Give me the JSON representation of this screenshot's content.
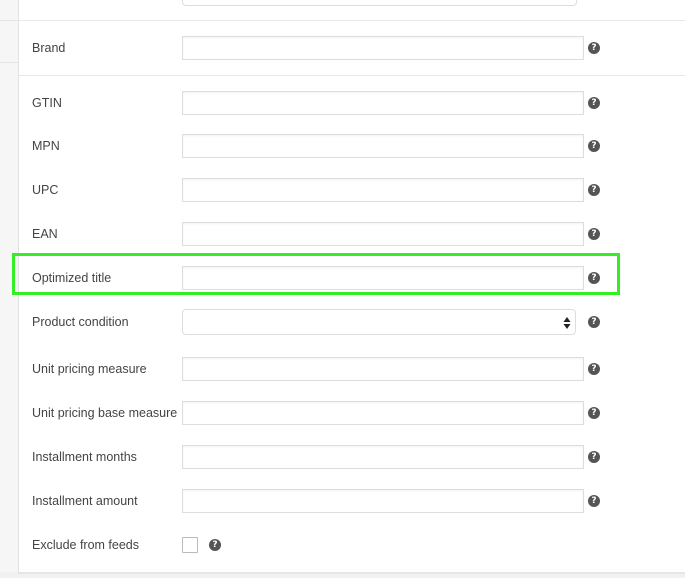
{
  "form": {
    "fields": [
      {
        "id": "brand",
        "label": "Brand",
        "type": "text",
        "value": "",
        "help": "?"
      },
      {
        "id": "gtin",
        "label": "GTIN",
        "type": "text",
        "value": "",
        "help": "?"
      },
      {
        "id": "mpn",
        "label": "MPN",
        "type": "text",
        "value": "",
        "help": "?"
      },
      {
        "id": "upc",
        "label": "UPC",
        "type": "text",
        "value": "",
        "help": "?"
      },
      {
        "id": "ean",
        "label": "EAN",
        "type": "text",
        "value": "",
        "help": "?"
      },
      {
        "id": "optimized-title",
        "label": "Optimized title",
        "type": "text",
        "value": "",
        "help": "?",
        "highlighted": true
      },
      {
        "id": "product-condition",
        "label": "Product condition",
        "type": "select",
        "value": "",
        "help": "?"
      },
      {
        "id": "unit-pricing-measure",
        "label": "Unit pricing measure",
        "type": "text",
        "value": "",
        "help": "?"
      },
      {
        "id": "unit-pricing-base-measure",
        "label": "Unit pricing base measure",
        "type": "text",
        "value": "",
        "help": "?"
      },
      {
        "id": "installment-months",
        "label": "Installment months",
        "type": "text",
        "value": "",
        "help": "?"
      },
      {
        "id": "installment-amount",
        "label": "Installment amount",
        "type": "text",
        "value": "",
        "help": "?"
      },
      {
        "id": "exclude-from-feeds",
        "label": "Exclude from feeds",
        "type": "checkbox",
        "checked": false,
        "help": "?"
      }
    ]
  },
  "colors": {
    "highlight": "#33ee22",
    "help_icon": "#555555"
  }
}
